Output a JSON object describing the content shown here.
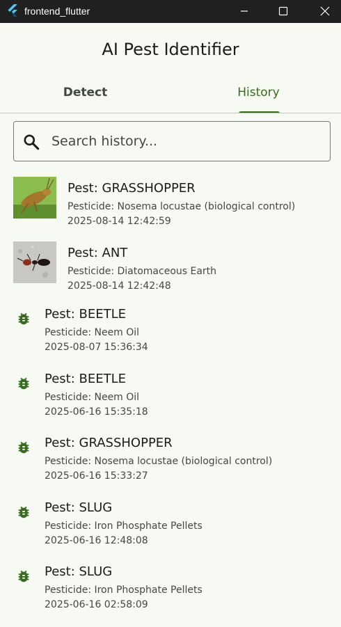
{
  "window": {
    "title": "frontend_flutter"
  },
  "app": {
    "title": "AI Pest Identifier"
  },
  "tabs": [
    {
      "label": "Detect"
    },
    {
      "label": "History"
    }
  ],
  "search": {
    "placeholder": "Search history..."
  },
  "history": [
    {
      "pest": "Pest: GRASSHOPPER",
      "pesticide": "Pesticide: Nosema locustae (biological control)",
      "date": "2025-08-14 12:42:59",
      "icon": "grasshopper-photo"
    },
    {
      "pest": "Pest: ANT",
      "pesticide": "Pesticide: Diatomaceous Earth",
      "date": "2025-08-14 12:42:48",
      "icon": "ant-photo"
    },
    {
      "pest": "Pest: BEETLE",
      "pesticide": "Pesticide: Neem Oil",
      "date": "2025-08-07 15:36:34",
      "icon": "bug-icon"
    },
    {
      "pest": "Pest: BEETLE",
      "pesticide": "Pesticide: Neem Oil",
      "date": "2025-06-16 15:35:18",
      "icon": "bug-icon"
    },
    {
      "pest": "Pest: GRASSHOPPER",
      "pesticide": "Pesticide: Nosema locustae (biological control)",
      "date": "2025-06-16 15:33:27",
      "icon": "bug-icon"
    },
    {
      "pest": "Pest: SLUG",
      "pesticide": "Pesticide: Iron Phosphate Pellets",
      "date": "2025-06-16 12:48:08",
      "icon": "bug-icon"
    },
    {
      "pest": "Pest: SLUG",
      "pesticide": "Pesticide: Iron Phosphate Pellets",
      "date": "2025-06-16 02:58:09",
      "icon": "bug-icon"
    }
  ],
  "colors": {
    "accent": "#386a20",
    "background": "#f7f9f3",
    "titlebar": "#202020"
  }
}
